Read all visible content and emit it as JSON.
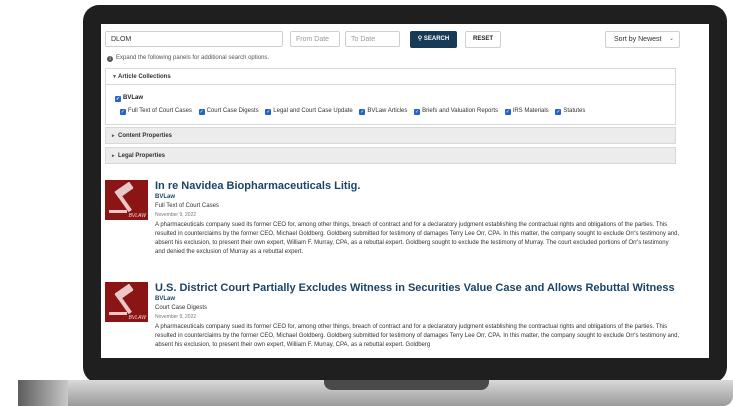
{
  "search": {
    "query": "DLOM",
    "from_placeholder": "From Date",
    "to_placeholder": "To Date",
    "search_label": "SEARCH",
    "reset_label": "RESET",
    "sort_value": "Sort by Newest"
  },
  "note": "Expand the following panels for additional search options.",
  "panels": {
    "article_collections": "Article Collections",
    "content_properties": "Content Properties",
    "legal_properties": "Legal Properties"
  },
  "collections": {
    "parent": "BVLaw",
    "items": [
      "Full Text of Court Cases",
      "Court Case Digests",
      "Legal and Court Case Update",
      "BVLaw Articles",
      "Briefs and Valuation Reports",
      "IRS Materials",
      "Statutes"
    ]
  },
  "articles": [
    {
      "logo_text": "BVLAW",
      "title": "In re Navidea Biopharmaceuticals Litig.",
      "source": "BVLaw",
      "category": "Full Text of Court Cases",
      "date": "November 9, 2022",
      "summary": "A pharmaceuticals company sued its former CEO for, among other things, breach of contract and for a declaratory judgment establishing the contractual rights and obligations of the parties. This resulted in counterclaims by the former CEO, Michael Goldberg. Goldberg submitted for testimony of damages Terry Lee Orr, CPA. In this matter, the company sought to exclude Orr's testimony and, absent his exclusion, to present their own expert, William F. Murray, CPA, as a rebuttal expert. Goldberg sought to exclude the testimony of Murray. The court excluded portions of Orr's testimony and denied the exclusion of Murray as a rebuttal expert."
    },
    {
      "logo_text": "BVLAW",
      "title": "U.S. District Court Partially Excludes Witness in Securities Value Case and Allows Rebuttal Witness",
      "source": "BVLaw",
      "category": "Court Case Digests",
      "date": "November 9, 2022",
      "summary": "A pharmaceuticals company sued its former CEO for, among other things, breach of contract and for a declaratory judgment establishing the contractual rights and obligations of the parties. This resulted in counterclaims by the former CEO, Michael Goldberg. Goldberg submitted for testimony of damages Terry Lee Orr, CPA. In this matter, the company sought to exclude Orr's testimony and, absent his exclusion, to present their own expert, William F. Murray, CPA, as a rebuttal expert. Goldberg"
    }
  ]
}
